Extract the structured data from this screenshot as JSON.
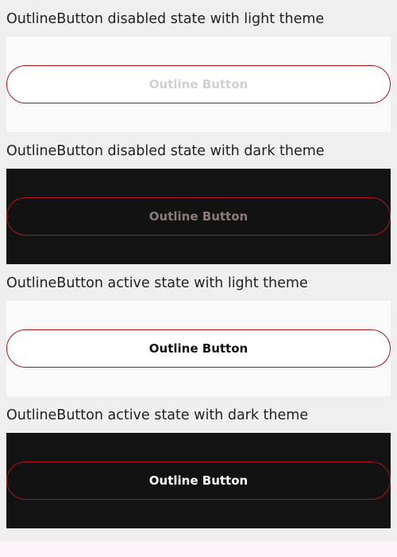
{
  "sections": [
    {
      "title": "OutlineButton disabled state with light theme",
      "theme": "light",
      "state": "disabled",
      "button_label": "Outline Button",
      "label_color": "#d0d0d0"
    },
    {
      "title": "OutlineButton disabled state with dark theme",
      "theme": "dark",
      "state": "disabled",
      "button_label": "Outline Button",
      "label_color": "#8a7a78"
    },
    {
      "title": "OutlineButton active state with light theme",
      "theme": "light",
      "state": "active",
      "button_label": "Outline Button",
      "label_color": "#111111"
    },
    {
      "title": "OutlineButton active state with dark theme",
      "theme": "dark",
      "state": "active",
      "button_label": "Outline Button",
      "label_color": "#ffffff"
    }
  ],
  "colors": {
    "page_background": "#efefef",
    "light_panel": "#fafafa",
    "dark_panel": "#131313",
    "button_border": "#b0141a"
  }
}
